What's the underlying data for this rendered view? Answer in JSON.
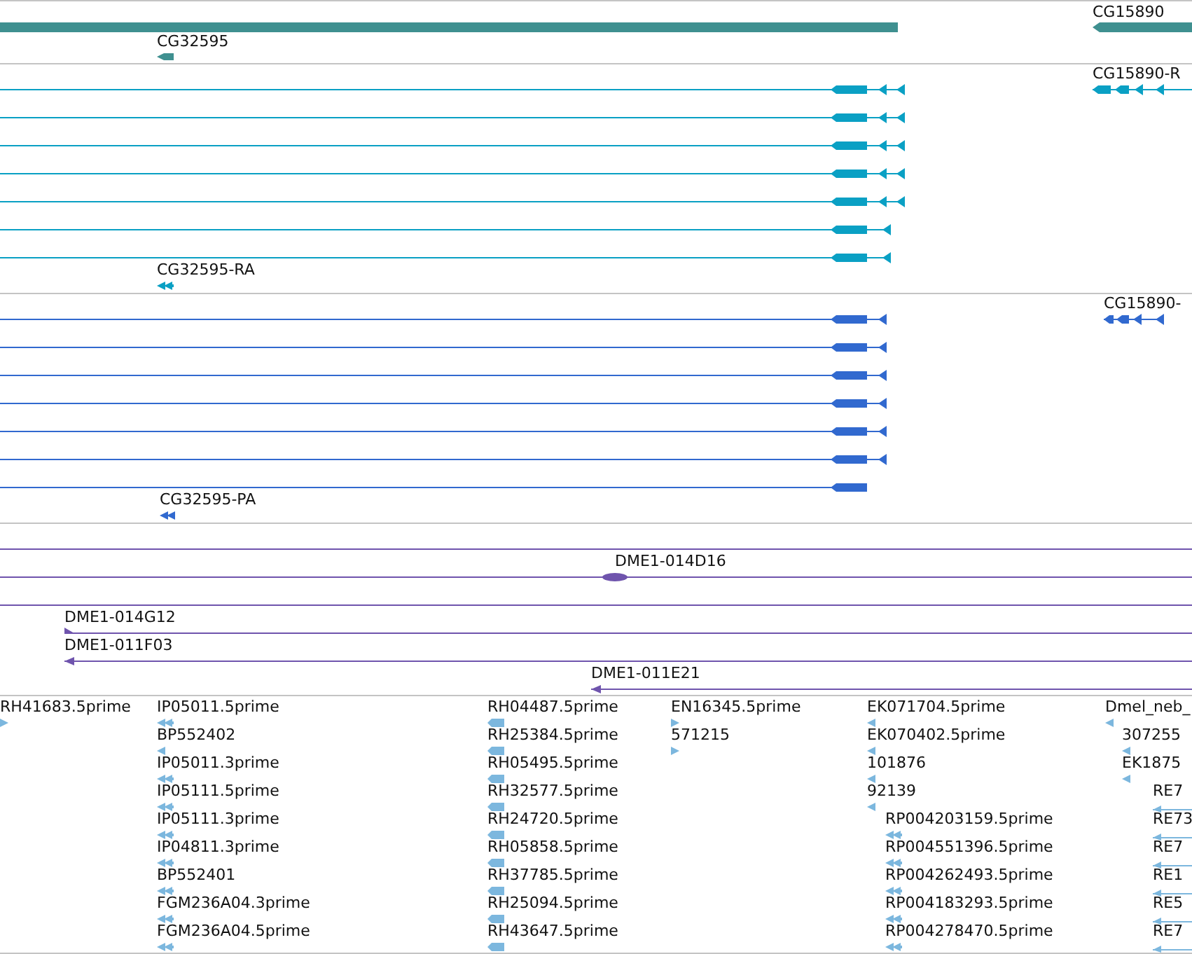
{
  "tracks": [
    {
      "color": "#3f9090",
      "features": [
        {
          "kind": "bar"
        },
        {
          "label": "CG15890",
          "kind": "bar",
          "reverse": true
        },
        {
          "label": "CG32595",
          "kind": "bar",
          "reverse": true
        }
      ]
    },
    {
      "color": "#0aa0c4",
      "features": [
        {
          "kind": "transcript",
          "reverse": true
        },
        {
          "kind": "transcript",
          "reverse": true
        },
        {
          "kind": "transcript",
          "reverse": true
        },
        {
          "kind": "transcript",
          "reverse": true
        },
        {
          "kind": "transcript",
          "reverse": true
        },
        {
          "kind": "transcript",
          "reverse": true
        },
        {
          "kind": "transcript",
          "reverse": true
        },
        {
          "label": "CG15890-R",
          "kind": "transcript",
          "reverse": true
        },
        {
          "label": "CG32595-RA",
          "kind": "double",
          "reverse": true
        }
      ]
    },
    {
      "color": "#3169cf",
      "features": [
        {
          "kind": "transcript",
          "reverse": true
        },
        {
          "kind": "transcript",
          "reverse": true
        },
        {
          "kind": "transcript",
          "reverse": true
        },
        {
          "kind": "transcript",
          "reverse": true
        },
        {
          "kind": "transcript",
          "reverse": true
        },
        {
          "kind": "transcript",
          "reverse": true
        },
        {
          "kind": "transcript",
          "reverse": true
        },
        {
          "label": "CG15890-",
          "kind": "transcript",
          "reverse": true
        },
        {
          "label": "CG32595-PA",
          "kind": "double",
          "reverse": true
        }
      ]
    },
    {
      "color": "#6f54ad",
      "features": [
        {
          "kind": "line"
        },
        {
          "label": "DME1-014D16",
          "kind": "marker"
        },
        {
          "kind": "line"
        },
        {
          "label": "DME1-014G12",
          "kind": "line",
          "reverse": false
        },
        {
          "label": "DME1-011F03",
          "kind": "line",
          "reverse": true
        },
        {
          "label": "DME1-011E21",
          "kind": "line",
          "reverse": true
        }
      ]
    },
    {
      "color": "#7cb7de",
      "features": [
        {
          "label": "RH41683.5prime",
          "kind": "single",
          "reverse": false
        },
        {
          "label": "IP05011.5prime",
          "kind": "double",
          "reverse": true
        },
        {
          "label": "BP552402",
          "kind": "single",
          "reverse": true
        },
        {
          "label": "IP05011.3prime",
          "kind": "double",
          "reverse": true
        },
        {
          "label": "IP05111.5prime",
          "kind": "double",
          "reverse": true
        },
        {
          "label": "IP05111.3prime",
          "kind": "double",
          "reverse": true
        },
        {
          "label": "IP04811.3prime",
          "kind": "double",
          "reverse": true
        },
        {
          "label": "BP552401",
          "kind": "double",
          "reverse": true
        },
        {
          "label": "FGM236A04.3prime",
          "kind": "double",
          "reverse": true
        },
        {
          "label": "FGM236A04.5prime",
          "kind": "double",
          "reverse": true
        },
        {
          "label": "RH04487.5prime",
          "kind": "block",
          "reverse": true
        },
        {
          "label": "RH25384.5prime",
          "kind": "block",
          "reverse": true
        },
        {
          "label": "RH05495.5prime",
          "kind": "block",
          "reverse": true
        },
        {
          "label": "RH32577.5prime",
          "kind": "block",
          "reverse": true
        },
        {
          "label": "RH24720.5prime",
          "kind": "block",
          "reverse": true
        },
        {
          "label": "RH05858.5prime",
          "kind": "block",
          "reverse": true
        },
        {
          "label": "RH37785.5prime",
          "kind": "block",
          "reverse": true
        },
        {
          "label": "RH25094.5prime",
          "kind": "block",
          "reverse": true
        },
        {
          "label": "RH43647.5prime",
          "kind": "block",
          "reverse": true
        },
        {
          "label": "EN16345.5prime",
          "kind": "single",
          "reverse": false
        },
        {
          "label": "571215",
          "kind": "single",
          "reverse": false
        },
        {
          "label": "EK071704.5prime",
          "kind": "single",
          "reverse": true
        },
        {
          "label": "EK070402.5prime",
          "kind": "single",
          "reverse": true
        },
        {
          "label": "101876",
          "kind": "single",
          "reverse": true
        },
        {
          "label": "92139",
          "kind": "single",
          "reverse": true
        },
        {
          "label": "RP004203159.5prime",
          "kind": "double",
          "reverse": true
        },
        {
          "label": "RP004551396.5prime",
          "kind": "double",
          "reverse": true
        },
        {
          "label": "RP004262493.5prime",
          "kind": "double",
          "reverse": true
        },
        {
          "label": "RP004183293.5prime",
          "kind": "double",
          "reverse": true
        },
        {
          "label": "RP004278470.5prime",
          "kind": "double",
          "reverse": true
        },
        {
          "label": "Dmel_neb_",
          "kind": "single",
          "reverse": true
        },
        {
          "label": "307255",
          "kind": "single",
          "reverse": true
        },
        {
          "label": "EK1875",
          "kind": "single",
          "reverse": true
        },
        {
          "label": "RE7",
          "kind": "line",
          "reverse": true
        },
        {
          "label": "RE73",
          "kind": "line",
          "reverse": true
        },
        {
          "label": "RE7",
          "kind": "line",
          "reverse": true
        },
        {
          "label": "RE1",
          "kind": "line",
          "reverse": true
        },
        {
          "label": "RE5",
          "kind": "line",
          "reverse": true
        },
        {
          "label": "RE7",
          "kind": "line",
          "reverse": true
        }
      ]
    }
  ]
}
